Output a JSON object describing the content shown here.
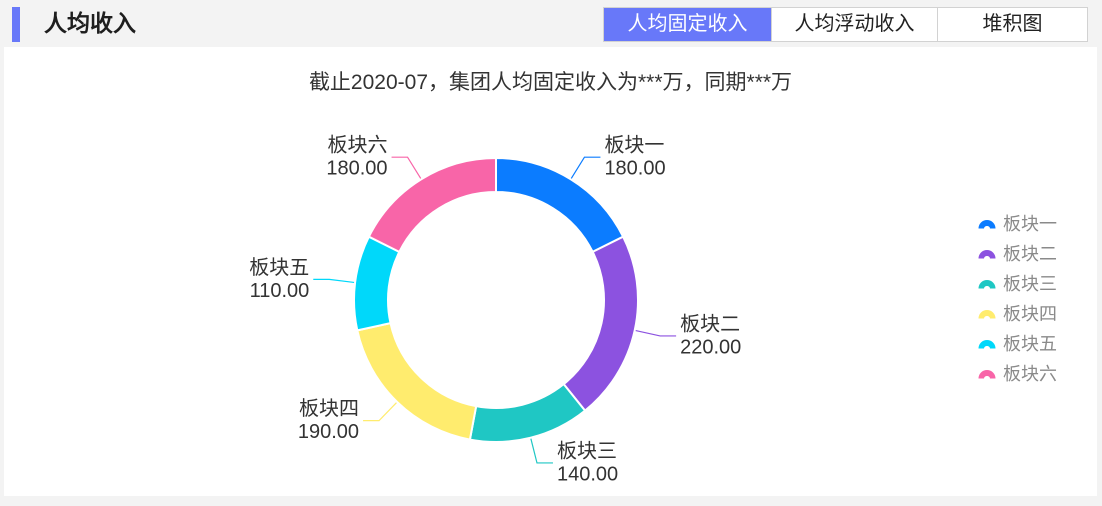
{
  "header": {
    "title": "人均收入",
    "accent_color": "#6878f9"
  },
  "tabs": [
    {
      "label": "人均固定收入",
      "active": true
    },
    {
      "label": "人均浮动收入",
      "active": false
    },
    {
      "label": "堆积图",
      "active": false
    }
  ],
  "chart_data": {
    "type": "pie",
    "title": "截止2020-07，集团人均固定收入为***万，同期***万",
    "categories": [
      "板块一",
      "板块二",
      "板块三",
      "板块四",
      "板块五",
      "板块六"
    ],
    "values": [
      180,
      220,
      140,
      190,
      110,
      180
    ],
    "colors": [
      "#0b7cff",
      "#8c52e0",
      "#1fc7c4",
      "#ffec6e",
      "#00d8fa",
      "#f865a8"
    ],
    "legend_position": "right"
  }
}
